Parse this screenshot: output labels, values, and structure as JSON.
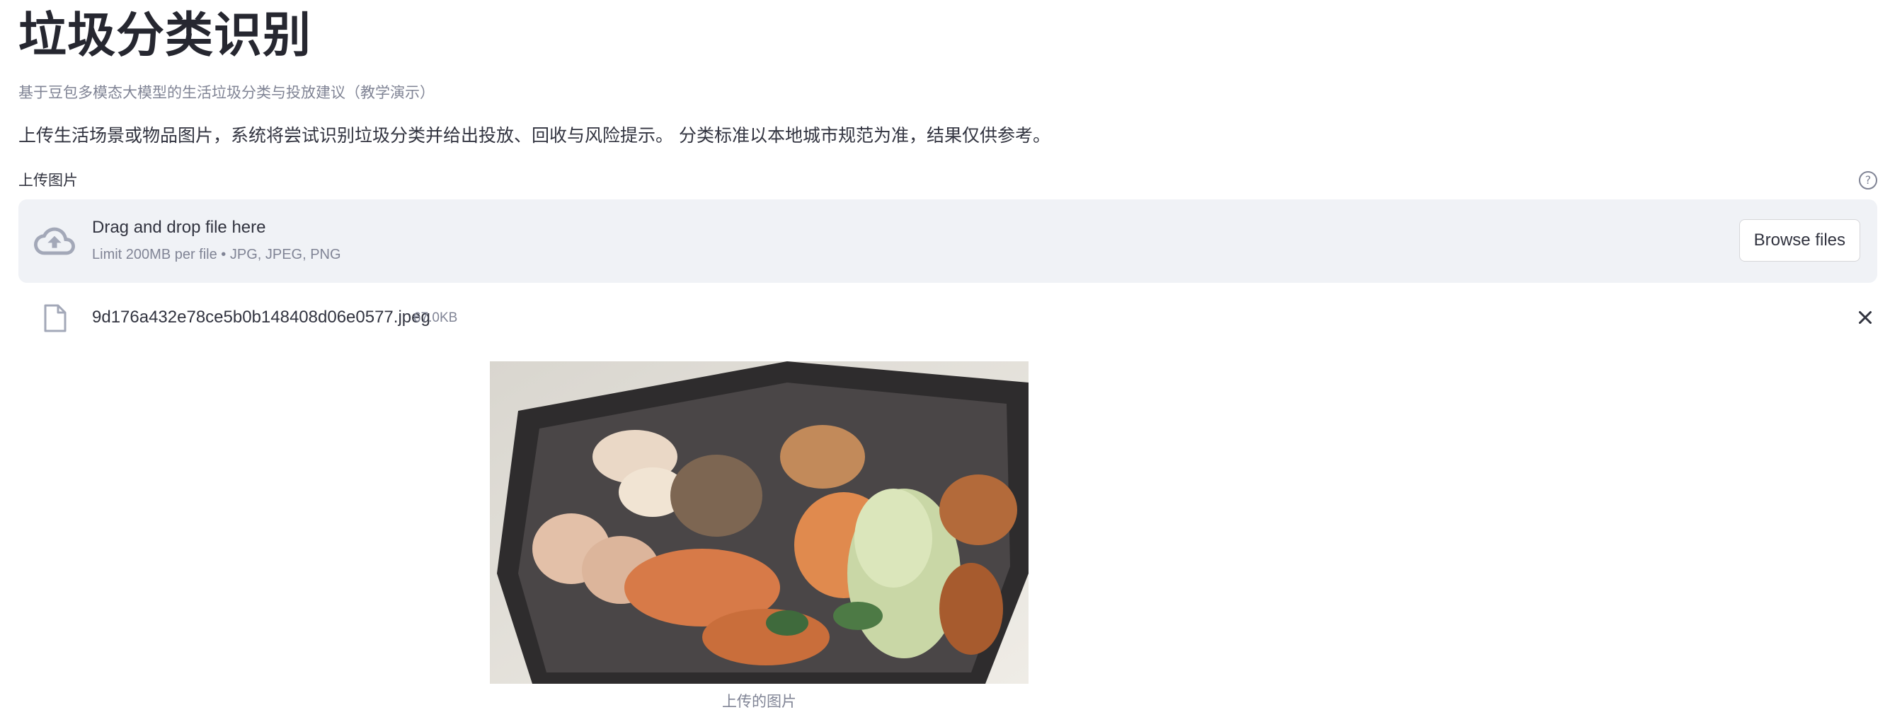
{
  "page": {
    "title": "垃圾分类识别",
    "subtitle": "基于豆包多模态大模型的生活垃圾分类与投放建议（教学演示）",
    "intro": "上传生活场景或物品图片，系统将尝试识别垃圾分类并给出投放、回收与风险提示。 分类标准以本地城市规范为准，结果仅供参考。"
  },
  "uploader": {
    "label": "上传图片",
    "help_icon": "question-circle-icon",
    "dropzone_text": "Drag and drop file here",
    "limit_text": "Limit 200MB per file • JPG, JPEG, PNG",
    "browse_label": "Browse files",
    "upload_icon": "cloud-upload-icon"
  },
  "uploaded_file": {
    "name": "9d176a432e78ce5b0b148408d06e0577.jpeg",
    "size": "67.0KB",
    "file_icon": "file-icon",
    "remove_icon": "close-icon"
  },
  "image": {
    "caption": "上传的图片"
  },
  "colors": {
    "dropzone_bg": "#f0f2f6",
    "muted_text": "#808495",
    "primary_text": "#31333f"
  }
}
